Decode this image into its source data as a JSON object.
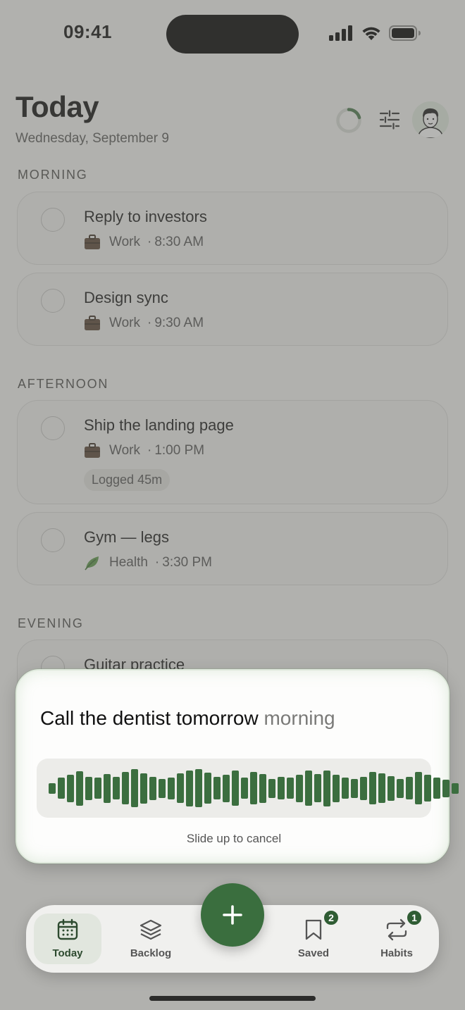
{
  "status_bar": {
    "time": "09:41"
  },
  "header": {
    "title": "Today",
    "date": "Wednesday, September 9"
  },
  "sections": [
    {
      "label": "MORNING"
    },
    {
      "label": "AFTERNOON"
    },
    {
      "label": "EVENING"
    }
  ],
  "tasks": [
    {
      "title": "Reply to investors",
      "category": "Work",
      "category_icon": "briefcase-icon",
      "time": "8:30 AM"
    },
    {
      "title": "Design sync",
      "category": "Work",
      "category_icon": "briefcase-icon",
      "time": "9:30 AM"
    },
    {
      "title": "Ship the landing page",
      "category": "Work",
      "category_icon": "briefcase-icon",
      "time": "1:00 PM",
      "chip": "Logged 45m"
    },
    {
      "title": "Gym — legs",
      "category": "Health",
      "category_icon": "leaf-icon",
      "time": "3:30 PM"
    },
    {
      "title": "Guitar practice"
    }
  ],
  "voice_input": {
    "transcript": "Call the dentist tomorrow",
    "pending": "morning",
    "hint": "Slide up to cancel",
    "waveform_levels": [
      0.28,
      0.55,
      0.72,
      0.9,
      0.62,
      0.55,
      0.75,
      0.6,
      0.85,
      1.0,
      0.8,
      0.62,
      0.5,
      0.58,
      0.78,
      0.95,
      1.0,
      0.82,
      0.6,
      0.72,
      0.92,
      0.55,
      0.86,
      0.76,
      0.5,
      0.6,
      0.56,
      0.72,
      0.92,
      0.74,
      0.95,
      0.72,
      0.55,
      0.5,
      0.62,
      0.86,
      0.78,
      0.65,
      0.5,
      0.6,
      0.86,
      0.7,
      0.55,
      0.46,
      0.28
    ],
    "accent_color": "#3b6e3f"
  },
  "tabbar": {
    "tabs": [
      {
        "label": "Today",
        "icon": "calendar-icon",
        "active": true
      },
      {
        "label": "Backlog",
        "icon": "layers-icon"
      },
      {
        "label": "Saved",
        "icon": "bookmark-icon",
        "badge": "2"
      },
      {
        "label": "Habits",
        "icon": "repeat-icon",
        "badge": "1"
      }
    ],
    "add_icon": "plus-icon"
  }
}
